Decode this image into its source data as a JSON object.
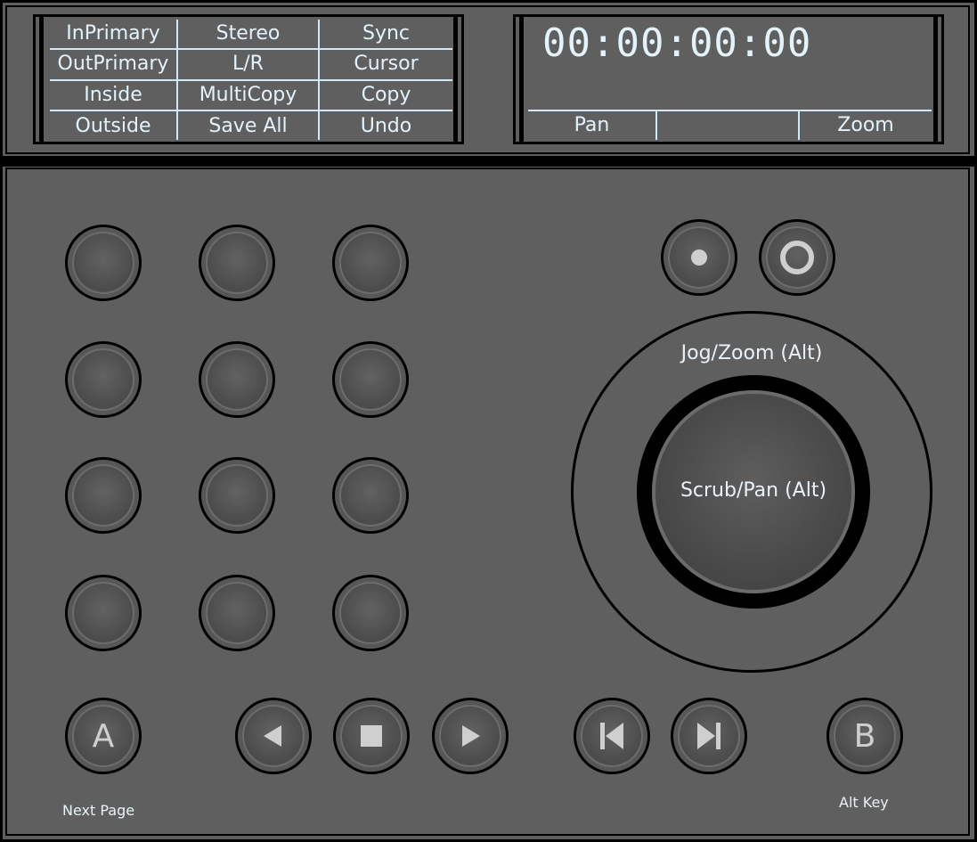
{
  "softkeys": {
    "row1": [
      "InPrimary",
      "Stereo",
      "Sync"
    ],
    "row2": [
      "OutPrimary",
      "L/R",
      "Cursor"
    ],
    "row3": [
      "Inside",
      "MultiCopy",
      "Copy"
    ],
    "row4": [
      "Outside",
      "Save All",
      "Undo"
    ]
  },
  "display": {
    "timecode": "00:00:00:00",
    "softkeys": [
      "Pan",
      "",
      "Zoom"
    ]
  },
  "jog": {
    "outer_label": "Jog/Zoom (Alt)",
    "inner_label": "Scrub/Pan (Alt)"
  },
  "buttons": {
    "a_label": "A",
    "b_label": "B"
  },
  "captions": {
    "next_page": "Next Page",
    "alt_key": "Alt Key"
  },
  "colors": {
    "panel": "#5f5f5f",
    "lcd_text": "#e4f3fb",
    "grid_lines": "#cfe9f6"
  }
}
